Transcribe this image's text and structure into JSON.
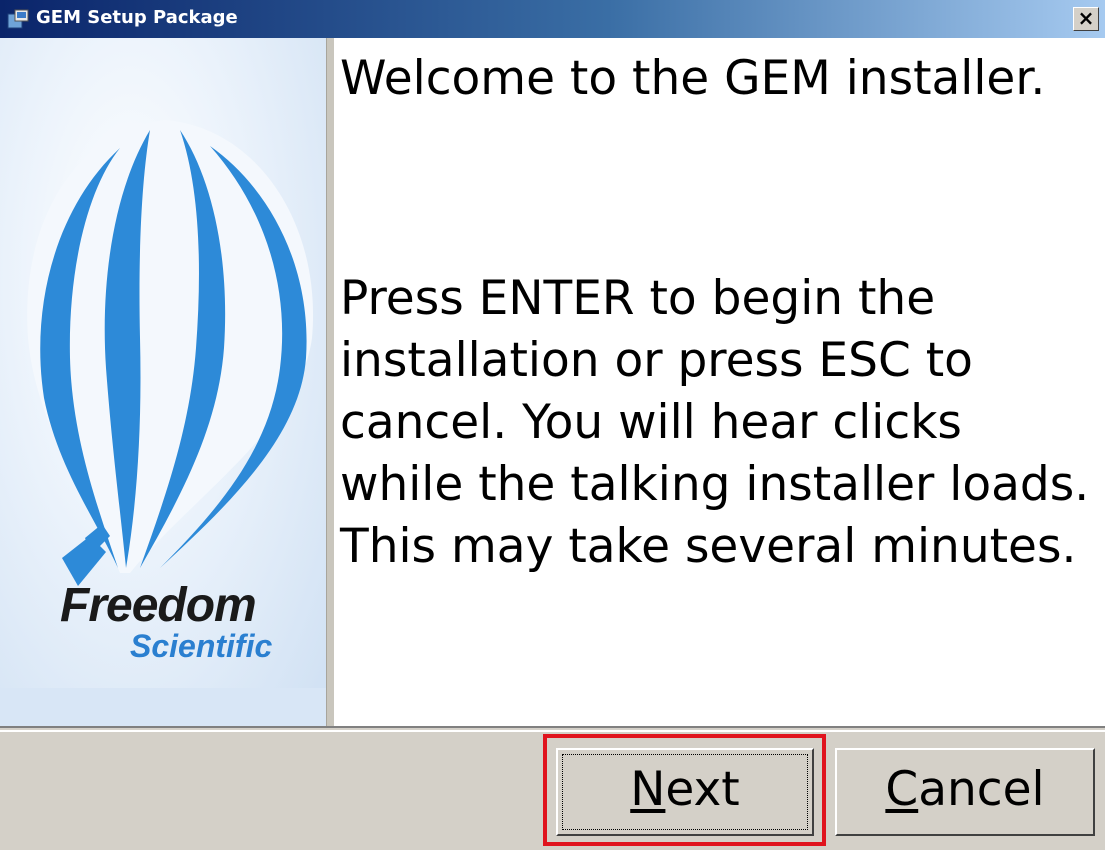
{
  "window": {
    "title": "GEM Setup Package",
    "close_glyph": "×",
    "icon": "installer-app-icon"
  },
  "sidebar": {
    "brand_line1": "Freedom",
    "brand_line2": "Scientific",
    "image": "hot-air-balloon-logo"
  },
  "content": {
    "welcome": "Welcome to the GEM installer.",
    "instructions": "Press ENTER to begin the installation or press ESC to cancel. You will hear clicks while the talking installer loads. This may take several minutes."
  },
  "buttons": {
    "next_mnemonic": "N",
    "next_rest": "ext",
    "cancel_mnemonic": "C",
    "cancel_rest": "ancel"
  },
  "colors": {
    "highlight": "#e0141e",
    "balloon_blue": "#2a7fd0",
    "title_bar": "#0a246a"
  }
}
